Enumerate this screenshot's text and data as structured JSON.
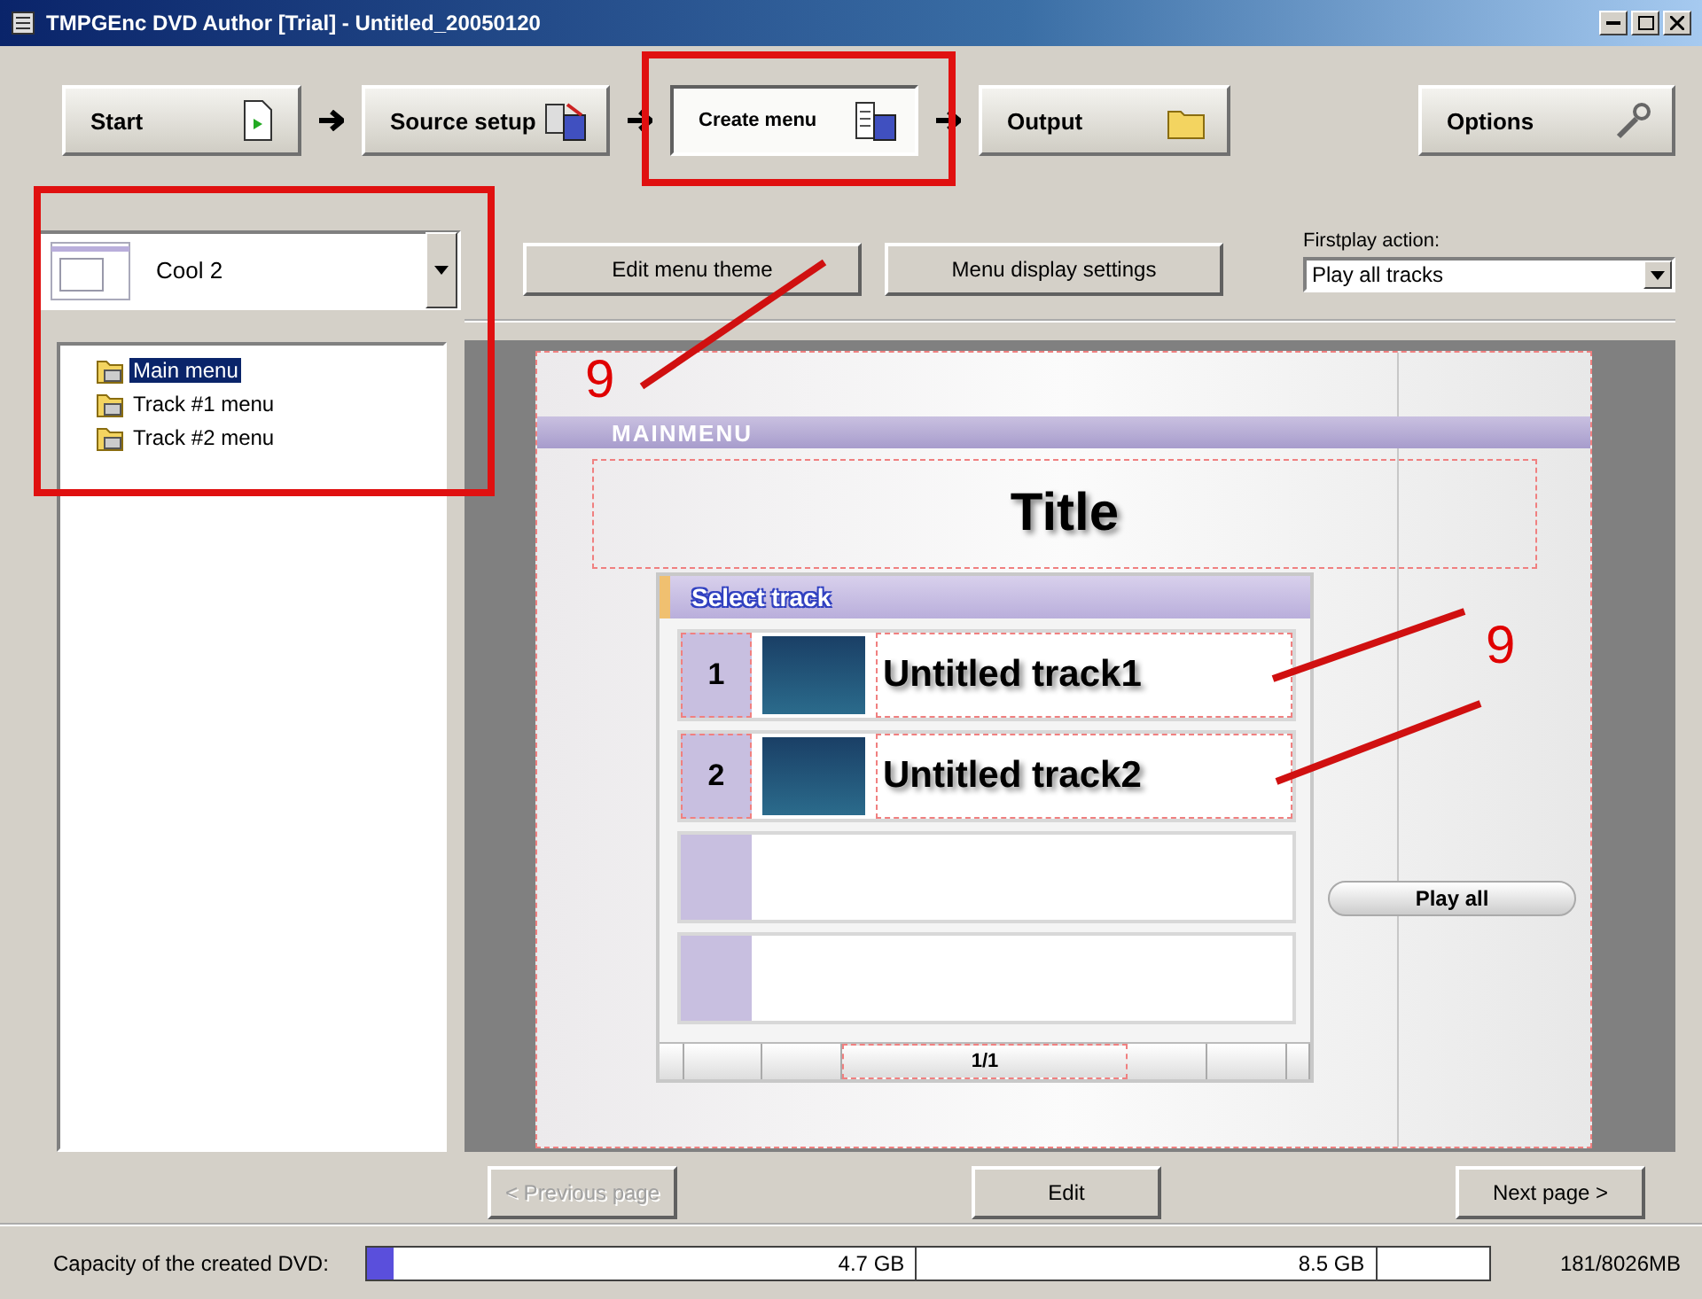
{
  "window": {
    "title": "TMPGEnc DVD Author [Trial] - Untitled_20050120"
  },
  "steps": [
    {
      "label": "Start",
      "selected": false
    },
    {
      "label": "Source setup",
      "selected": false
    },
    {
      "label": "Create menu",
      "selected": true
    },
    {
      "label": "Output",
      "selected": false
    }
  ],
  "options_button": {
    "label": "Options"
  },
  "theme_select": {
    "value": "Cool 2"
  },
  "menu_tree": [
    {
      "label": "Main menu",
      "selected": true
    },
    {
      "label": "Track #1 menu",
      "selected": false
    },
    {
      "label": "Track #2 menu",
      "selected": false
    }
  ],
  "toolbar": {
    "buttons": [
      "Edit menu theme",
      "Menu display settings"
    ],
    "firstplay": {
      "label": "Firstplay action:",
      "value": "Play all tracks"
    }
  },
  "preview": {
    "header": "MAINMENU",
    "title": "Title",
    "panel_title": "Select track",
    "rows": [
      {
        "kind": "track",
        "number": "1",
        "title": "Untitled track1"
      },
      {
        "kind": "track",
        "number": "2",
        "title": "Untitled track2"
      },
      {
        "kind": "empty"
      },
      {
        "kind": "empty"
      }
    ],
    "page": "1/1",
    "play_all": "Play all"
  },
  "nav": [
    {
      "label": "< Previous page",
      "disabled": true
    },
    {
      "label": "Edit",
      "disabled": false
    },
    {
      "label": "Next page >",
      "disabled": false
    }
  ],
  "status": {
    "label": "Capacity of the created DVD:",
    "level": 0.023,
    "marks": [
      "4.7 GB",
      "8.5 GB"
    ],
    "usage": "181/8026MB"
  },
  "annotations": [
    {
      "label": "9"
    },
    {
      "label": "9"
    }
  ]
}
